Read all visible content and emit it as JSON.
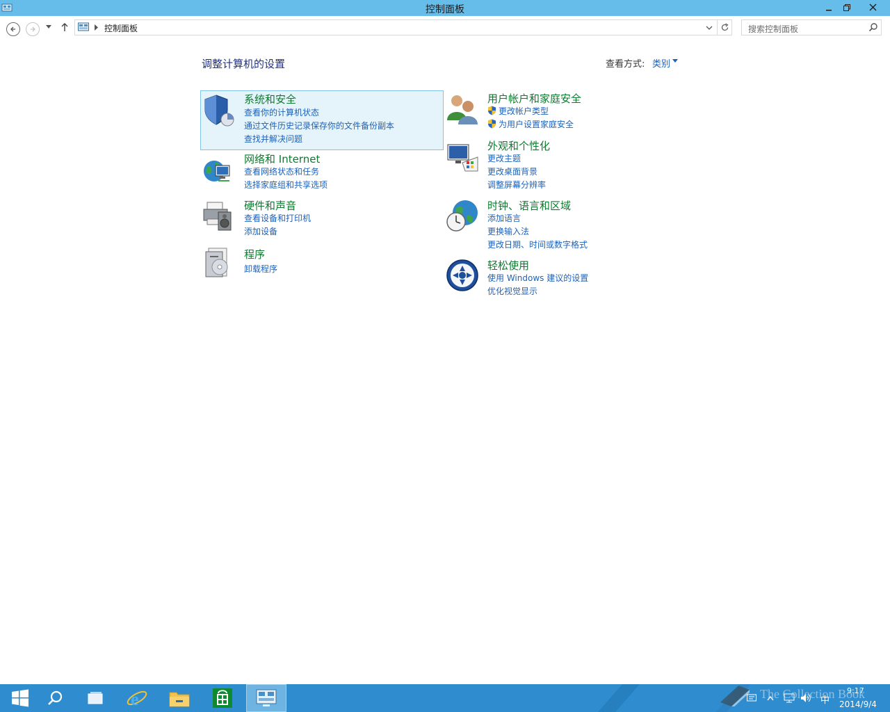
{
  "window": {
    "title": "控制面板",
    "minimize_label": "—",
    "maximize_label": "❐",
    "close_label": "✕"
  },
  "navigation": {
    "breadcrumb_current": "控制面板",
    "search_placeholder": "搜索控制面板"
  },
  "main": {
    "page_title": "调整计算机的设置",
    "view_by_label": "查看方式:",
    "view_by_value": "类别"
  },
  "categories": [
    {
      "heading": "系统和安全",
      "icon": "shield-icon",
      "links": [
        "查看你的计算机状态",
        "通过文件历史记录保存你的文件备份副本",
        "查找并解决问题"
      ]
    },
    {
      "heading": "网络和 Internet",
      "icon": "network-globe-icon",
      "links": [
        "查看网络状态和任务",
        "选择家庭组和共享选项"
      ]
    },
    {
      "heading": "硬件和声音",
      "icon": "printer-speaker-icon",
      "links": [
        "查看设备和打印机",
        "添加设备"
      ]
    },
    {
      "heading": "程序",
      "icon": "programs-disc-icon",
      "links": [
        "卸载程序"
      ]
    },
    {
      "heading": "用户帐户和家庭安全",
      "icon": "users-icon",
      "links": [
        "更改帐户类型",
        "为用户设置家庭安全"
      ]
    },
    {
      "heading": "外观和个性化",
      "icon": "monitor-palette-icon",
      "links": [
        "更改主题",
        "更改桌面背景",
        "调整屏幕分辨率"
      ]
    },
    {
      "heading": "时钟、语言和区域",
      "icon": "clock-globe-icon",
      "links": [
        "添加语言",
        "更换输入法",
        "更改日期、时间或数字格式"
      ]
    },
    {
      "heading": "轻松使用",
      "icon": "ease-of-access-icon",
      "links": [
        "使用 Windows 建议的设置",
        "优化视觉显示"
      ]
    }
  ],
  "taskbar": {
    "items": [
      "start-icon",
      "search-icon",
      "task-view-icon",
      "internet-explorer-icon",
      "file-explorer-icon",
      "store-icon",
      "control-panel-icon"
    ],
    "ime_label": "中",
    "clock_time": "9:17",
    "clock_date": "2014/9/4",
    "watermark": "The Collection Book"
  },
  "colors": {
    "titlebar": "#67bdea",
    "taskbar": "#2e8ccf",
    "heading_green": "#0d7a2e",
    "link_blue": "#1e62b8",
    "page_title_blue": "#1e3287",
    "selected_bg": "#e5f3fb"
  }
}
